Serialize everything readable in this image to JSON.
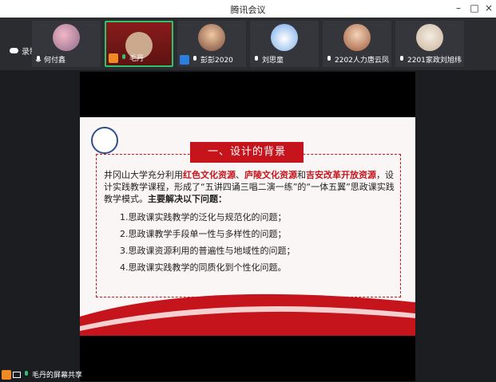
{
  "window": {
    "title": "腾讯会议",
    "minimize": "–",
    "maximize": "□",
    "close": "×"
  },
  "recording": {
    "label": "录制中"
  },
  "participants": [
    {
      "name": "何付鑫"
    },
    {
      "name": "毛丹"
    },
    {
      "name": "彭彭2020"
    },
    {
      "name": "刘思童"
    },
    {
      "name": "2202人力唐云凤"
    },
    {
      "name": "2201家政刘旭纬"
    }
  ],
  "slide": {
    "heading": "一、设计的背景",
    "intro_a": "井冈山大学充分利用",
    "red1": "红色文化资源",
    "sep1": "、",
    "red2": "庐陵文化资源",
    "and": "和",
    "red3": "吉安改革开放资源",
    "intro_b": "，设计实践教学课程，形成了“五讲四诵三唱二演一练”的“一体五翼”思政课实践教学模式。",
    "bold": "主要解决以下问题：",
    "items": [
      "1.思政课实践教学的泛化与规范化的问题；",
      "2.思政课教学手段单一性与多样性的问题；",
      "3.思政课资源利用的普遍性与地域性的问题；",
      "4.思政课实践教学的同质化到个性化问题。"
    ]
  },
  "screen_share": {
    "label": "毛丹的屏幕共享"
  }
}
